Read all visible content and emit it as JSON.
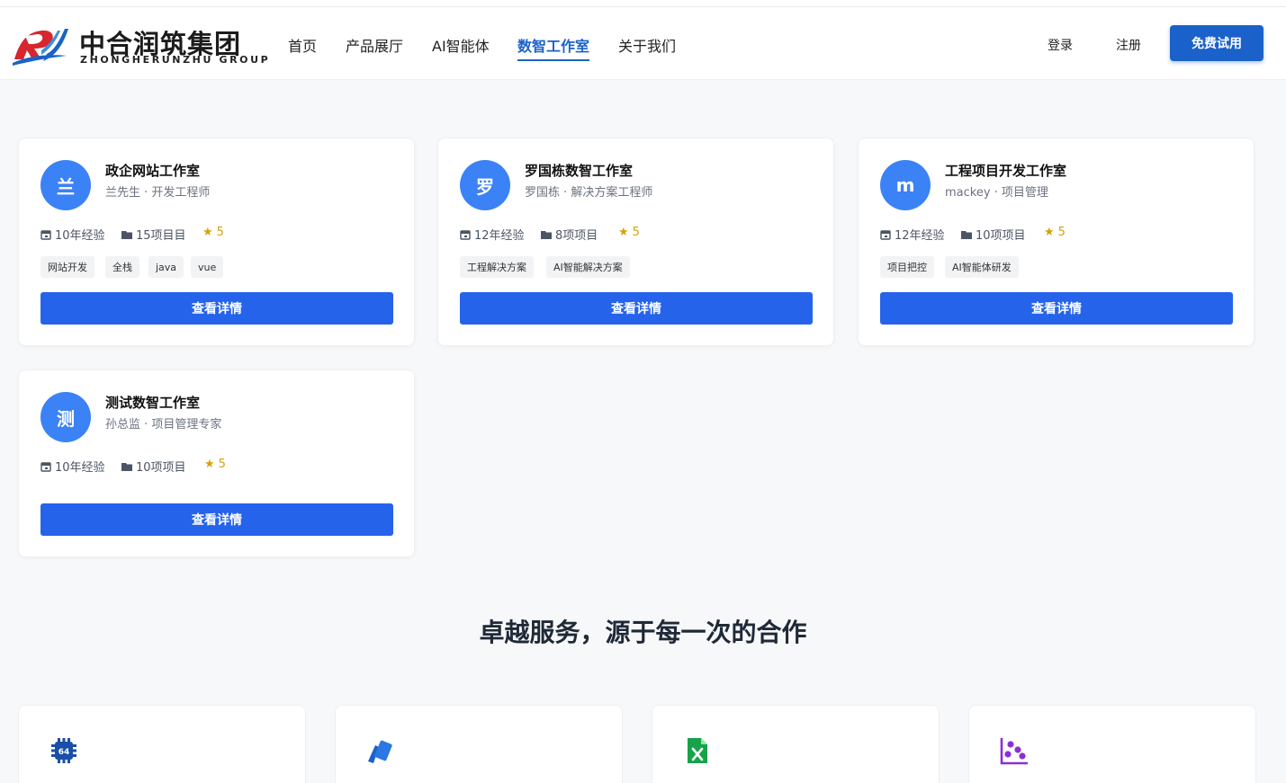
{
  "brand": {
    "name_cn": "中合润筑集团",
    "name_en": "ZHONGHERUNZHU GROUP",
    "colors": {
      "red": "#d7262d",
      "blue": "#1a62c9"
    }
  },
  "nav": {
    "items": [
      {
        "label": "首页",
        "active": false
      },
      {
        "label": "产品展厅",
        "active": false
      },
      {
        "label": "AI智能体",
        "active": false
      },
      {
        "label": "数智工作室",
        "active": true
      },
      {
        "label": "关于我们",
        "active": false
      }
    ],
    "login": "登录",
    "register": "注册",
    "trial": "免费试用"
  },
  "studios": [
    {
      "avatar": "兰",
      "title": "政企网站工作室",
      "subtitle": "兰先生 · 开发工程师",
      "experience": "10年经验",
      "projects": "15项目目",
      "rating": "5",
      "tags": [
        "网站开发",
        "全栈",
        "java",
        "vue"
      ],
      "button": "查看详情"
    },
    {
      "avatar": "罗",
      "title": "罗国栋数智工作室",
      "subtitle": "罗国栋 · 解决方案工程师",
      "experience": "12年经验",
      "projects": "8项项目",
      "rating": "5",
      "tags": [
        "工程解决方案",
        "AI智能解决方案"
      ],
      "button": "查看详情"
    },
    {
      "avatar": "m",
      "title": "工程项目开发工作室",
      "subtitle": "mackey · 项目管理",
      "experience": "12年经验",
      "projects": "10项项目",
      "rating": "5",
      "tags": [
        "项目把控",
        "AI智能体研发"
      ],
      "button": "查看详情"
    },
    {
      "avatar": "测",
      "title": "测试数智工作室",
      "subtitle": "孙总监 · 项目管理专家",
      "experience": "10年经验",
      "projects": "10项项目",
      "rating": "5",
      "tags": [],
      "button": "查看详情"
    }
  ],
  "services": {
    "title": "卓越服务，源于每一次的合作",
    "icons": [
      "chip-64-icon",
      "cards-icon",
      "excel-file-icon",
      "scatter-chart-icon"
    ]
  }
}
